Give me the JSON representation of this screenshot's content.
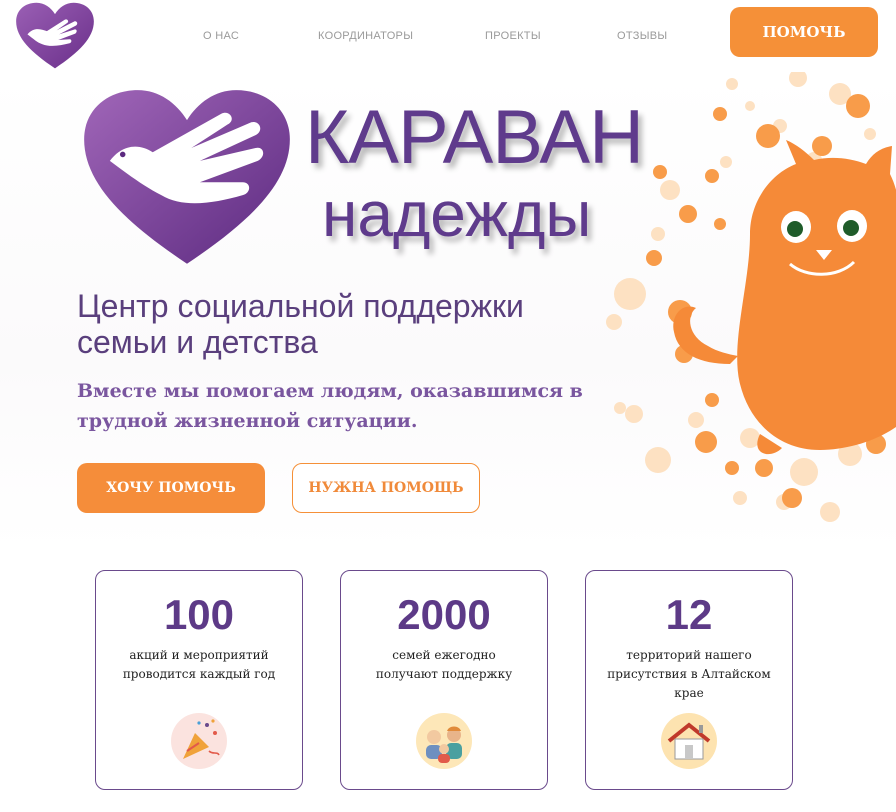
{
  "nav": {
    "items": [
      {
        "label": "О НАС"
      },
      {
        "label": "КООРДИНАТОРЫ"
      },
      {
        "label": "ПРОЕКТЫ"
      },
      {
        "label": "ОТЗЫВЫ"
      }
    ],
    "help_label": "ПОМОЧЬ"
  },
  "hero": {
    "brand_line1": "КАРАВАН",
    "brand_line2": "надежды",
    "subtitle": "Центр социальной поддержки семьи и детства",
    "tagline": "Вместе мы помогаем людям, оказавшимся в трудной жизненной ситуации.",
    "button_want": "ХОЧУ ПОМОЧЬ",
    "button_need": "НУЖНА ПОМОЩЬ"
  },
  "stats": [
    {
      "number": "100",
      "text": "акций и мероприятий проводится каждый год",
      "icon": "party-popper-icon"
    },
    {
      "number": "2000",
      "text": "семей ежегодно получают поддержку",
      "icon": "family-icon"
    },
    {
      "number": "12",
      "text": "территорий нашего присутствия в Алтайском крае",
      "icon": "house-icon"
    }
  ],
  "colors": {
    "brand_purple": "#5f3b8c",
    "accent_orange": "#f59038",
    "card_border": "#6a4a8c"
  }
}
